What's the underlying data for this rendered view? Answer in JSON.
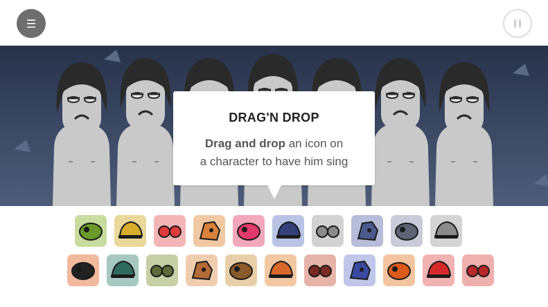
{
  "topbar": {
    "menu_glyph": "☰",
    "menu_icon": "menu-icon",
    "pause_icon": "pause-icon"
  },
  "stage": {
    "character_count": 7
  },
  "popup": {
    "title": "DRAG'N DROP",
    "body_bold": "Drag and drop",
    "body_line1_rest": " an icon on",
    "body_line2": "a character to have him sing"
  },
  "colors": {
    "stage_bg": "#2f3b55",
    "skin": "#c9c9c9",
    "hair": "#2a2a2a",
    "tile_greenish": "#c5d8a3",
    "tile_orange": "#f2c2a2",
    "tile_pink": "#f2b2be",
    "tile_blue": "#b7c4e8",
    "tile_grey": "#c9c9c9"
  },
  "icons": {
    "row1": [
      {
        "name": "green-leaf-hat-icon",
        "bg": "#c8dca0",
        "fg": "#6a9a2a"
      },
      {
        "name": "yellow-cap-icon",
        "bg": "#ead79a",
        "fg": "#d8ad2b"
      },
      {
        "name": "red-glasses-icon",
        "bg": "#f3b5b5",
        "fg": "#e03a3a"
      },
      {
        "name": "orange-hat-icon",
        "bg": "#f0c9a4",
        "fg": "#d9823c"
      },
      {
        "name": "pink-dotted-hat-icon",
        "bg": "#f3a7bb",
        "fg": "#e23a6a"
      },
      {
        "name": "blue-goggles-icon",
        "bg": "#b9c3e6",
        "fg": "#33407a"
      },
      {
        "name": "grey-bubbles-icon",
        "bg": "#d2d2d2",
        "fg": "#8b8b8b"
      },
      {
        "name": "blue-hood-icon",
        "bg": "#b7bdd8",
        "fg": "#4b5a8c"
      },
      {
        "name": "grey-mask-icon",
        "bg": "#c9ccd8",
        "fg": "#5e6474"
      },
      {
        "name": "life-cap-icon",
        "bg": "#d4d4d4",
        "fg": "#8a8a8a"
      }
    ],
    "row2": [
      {
        "name": "black-headphone-icon",
        "bg": "#f1b99e",
        "fg": "#222222"
      },
      {
        "name": "green-helmet-icon",
        "bg": "#a6c8c0",
        "fg": "#2f6a5e"
      },
      {
        "name": "green-face-icon",
        "bg": "#c6cfa6",
        "fg": "#5d6b3a"
      },
      {
        "name": "orange-mustache-icon",
        "bg": "#f1cdb0",
        "fg": "#b56a37"
      },
      {
        "name": "brown-octopus-icon",
        "bg": "#e8cfaa",
        "fg": "#8a5a2a"
      },
      {
        "name": "orange-flame-icon",
        "bg": "#f3c7a2",
        "fg": "#d9692a"
      },
      {
        "name": "red-totem-icon",
        "bg": "#e6b3a9",
        "fg": "#7a2a22"
      },
      {
        "name": "blue-tube-icon",
        "bg": "#bfc6ea",
        "fg": "#3a4aa0"
      },
      {
        "name": "orange-sun-icon",
        "bg": "#f4c4a0",
        "fg": "#dd5a1a"
      },
      {
        "name": "red-ribbon-icon",
        "bg": "#f3b2b2",
        "fg": "#d82a2a"
      },
      {
        "name": "red-cherry-icon",
        "bg": "#efb0ad",
        "fg": "#b8282a"
      }
    ]
  }
}
